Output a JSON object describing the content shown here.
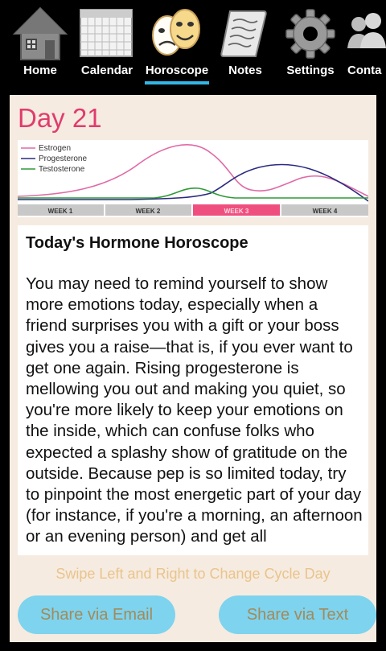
{
  "tabs": [
    {
      "label": "Home",
      "icon": "home-icon"
    },
    {
      "label": "Calendar",
      "icon": "calendar-icon"
    },
    {
      "label": "Horoscope",
      "icon": "theater-masks-icon",
      "selected": true
    },
    {
      "label": "Notes",
      "icon": "scroll-icon"
    },
    {
      "label": "Settings",
      "icon": "gear-icon"
    },
    {
      "label": "Conta",
      "icon": "contacts-icon"
    }
  ],
  "day_title": "Day 21",
  "chart": {
    "legend": [
      "Estrogen",
      "Progesterone",
      "Testosterone"
    ],
    "weeks": [
      "WEEK 1",
      "WEEK 2",
      "WEEK 3",
      "WEEK 4"
    ],
    "current_week": "WEEK 3",
    "colors": {
      "estrogen": "#e06aa6",
      "progesterone": "#2a2a80",
      "testosterone": "#2e9a38",
      "week_active": "#ef4f7f",
      "week_inactive": "#c8c8c8"
    }
  },
  "horoscope": {
    "heading": "Today's Hormone Horoscope",
    "body": "You may need to remind yourself to show more emotions today, especially when a friend surprises you with a gift or your boss gives you a raise—that is, if you ever want to get one again. Rising progesterone is mellowing you out and making you quiet, so you're more likely to keep your emotions on the inside, which can confuse folks who expected a splashy show of gratitude on the outside. Because pep is so limited today, try to pinpoint the most energetic part of your day (for instance, if you're a morning, an afternoon or an evening person) and get all"
  },
  "swipe_hint": "Swipe Left and Right to Change Cycle Day",
  "buttons": {
    "email": "Share via Email",
    "text": "Share via Text"
  }
}
